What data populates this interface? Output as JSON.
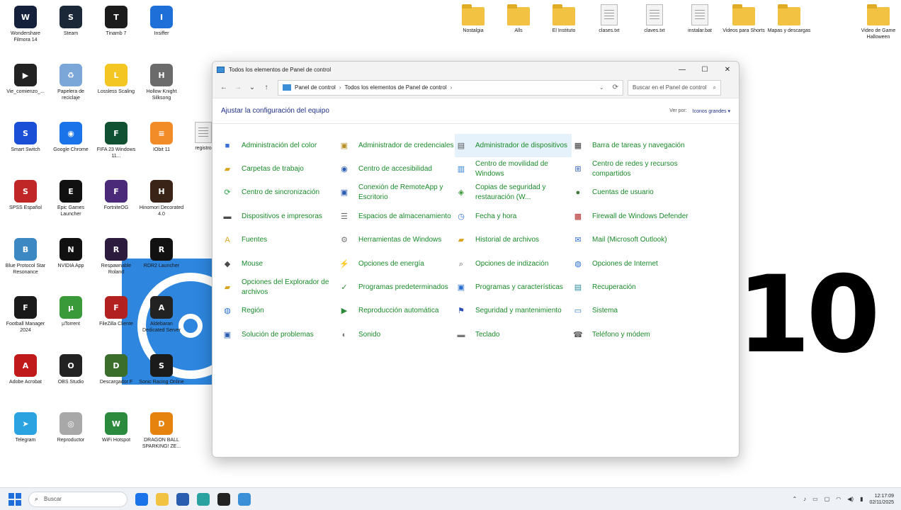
{
  "desktop": {
    "left_icons": [
      {
        "label": "Wondershare Filmora 14",
        "glyph": "W",
        "color": "#15203a"
      },
      {
        "label": "Steam",
        "glyph": "S",
        "color": "#1b2838"
      },
      {
        "label": "Tinamb 7",
        "glyph": "T",
        "color": "#1b1b1b"
      },
      {
        "label": "Insiffer",
        "glyph": "I",
        "color": "#1f6fd9"
      },
      {
        "label": "Vie_comienzo_...",
        "glyph": "▶",
        "color": "#222222"
      },
      {
        "label": "Papelera de reciclaje",
        "glyph": "♻",
        "color": "#7aa7d8"
      },
      {
        "label": "Lossless Scaling",
        "glyph": "L",
        "color": "#f3c623"
      },
      {
        "label": "Hollow Knight Silksong",
        "glyph": "H",
        "color": "#6b6b6b"
      },
      {
        "label": "Smart Switch",
        "glyph": "S",
        "color": "#1a4fd6"
      },
      {
        "label": "Google Chrome",
        "glyph": "◉",
        "color": "#1a73e8"
      },
      {
        "label": "FIFA 23 Windows 11...",
        "glyph": "F",
        "color": "#0f5132"
      },
      {
        "label": "IObit 11",
        "glyph": "≡",
        "color": "#f28c28"
      },
      {
        "label": "SPSS Español",
        "glyph": "S",
        "color": "#c02626"
      },
      {
        "label": "Epic Games Launcher",
        "glyph": "E",
        "color": "#111111"
      },
      {
        "label": "FortniteOG",
        "glyph": "F",
        "color": "#4c2a7a"
      },
      {
        "label": "Hinomori Decorated 4.0",
        "glyph": "H",
        "color": "#3a2418"
      },
      {
        "label": "Blue Protocol Star Resonance",
        "glyph": "B",
        "color": "#3b88c3"
      },
      {
        "label": "NVIDIA App",
        "glyph": "N",
        "color": "#111111"
      },
      {
        "label": "Respawnable Roland",
        "glyph": "R",
        "color": "#2d1b3d"
      },
      {
        "label": "RDR2 Launcher",
        "glyph": "R",
        "color": "#111111"
      },
      {
        "label": "Football Manager 2024",
        "glyph": "F",
        "color": "#1a1a1a"
      },
      {
        "label": "µTorrent",
        "glyph": "µ",
        "color": "#3a9a3a"
      },
      {
        "label": "FileZilla Cliente",
        "glyph": "F",
        "color": "#b32020"
      },
      {
        "label": "Aldebaran Dedicated Server",
        "glyph": "A",
        "color": "#222222"
      },
      {
        "label": "Adobe Acrobat",
        "glyph": "A",
        "color": "#c11a1a"
      },
      {
        "label": "OBS Studio",
        "glyph": "O",
        "color": "#222222"
      },
      {
        "label": "Descargador F",
        "glyph": "D",
        "color": "#3a6e2a"
      },
      {
        "label": "Sonic Racing Online",
        "glyph": "S",
        "color": "#1b1b1b"
      },
      {
        "label": "Telegram",
        "glyph": "➤",
        "color": "#2aa3e0"
      },
      {
        "label": "Reproductor",
        "glyph": "◎",
        "color": "#a8a8a8"
      },
      {
        "label": "WiFi Hotspot",
        "glyph": "W",
        "color": "#2b8a3e"
      },
      {
        "label": "DRAGON BALL SPARKING! ZE...",
        "glyph": "D",
        "color": "#e6820e"
      },
      {
        "label": "registro",
        "glyph": "",
        "color": "#f3f3f3"
      }
    ],
    "top_icons": [
      {
        "label": "Nostalgia",
        "type": "folder"
      },
      {
        "label": "Alls",
        "type": "folder"
      },
      {
        "label": "El Instituto",
        "type": "folder"
      },
      {
        "label": "clases.txt",
        "type": "doc"
      },
      {
        "label": "claves.txt",
        "type": "doc"
      },
      {
        "label": "instalar.bat",
        "type": "doc"
      },
      {
        "label": "Videos para Shorts",
        "type": "folder"
      },
      {
        "label": "Mapas y descargas",
        "type": "folder"
      },
      {
        "label": "Video de Game Halloween",
        "type": "folder"
      }
    ],
    "overlay_number": "10"
  },
  "window": {
    "title": "Todos los elementos de Panel de control",
    "min_glyph": "—",
    "max_glyph": "☐",
    "close_glyph": "✕",
    "nav": {
      "back": "←",
      "forward": "→",
      "recent": "⌄",
      "up": "↑"
    },
    "path": [
      "Panel de control",
      "Todos los elementos de Panel de control"
    ],
    "path_sep": "›",
    "path_dropdown": "⌄",
    "refresh": "⟳",
    "search_placeholder": "Buscar en el Panel de control",
    "search_icon": "⌕",
    "heading": "Ajustar la configuración del equipo",
    "view_by_label": "Ver por:",
    "view_by_value": "Iconos grandes ▾",
    "items": [
      {
        "label": "Administración del color",
        "icon": "color-management-icon",
        "glyph": "■",
        "color": "#3b6fd6"
      },
      {
        "label": "Administrador de credenciales",
        "icon": "credential-manager-icon",
        "glyph": "▣",
        "color": "#b8902a"
      },
      {
        "label": "Administrador de dispositivos",
        "icon": "device-manager-icon",
        "glyph": "▤",
        "color": "#555555",
        "selected": true
      },
      {
        "label": "Barra de tareas y navegación",
        "icon": "taskbar-icon",
        "glyph": "▦",
        "color": "#3a3a3a"
      },
      {
        "label": "Carpetas de trabajo",
        "icon": "work-folders-icon",
        "glyph": "▰",
        "color": "#d9a420"
      },
      {
        "label": "Centro de accesibilidad",
        "icon": "accessibility-icon",
        "glyph": "◉",
        "color": "#2a5db0"
      },
      {
        "label": "Centro de movilidad de Windows",
        "icon": "mobility-center-icon",
        "glyph": "▥",
        "color": "#2a7ad0"
      },
      {
        "label": "Centro de redes y recursos compartidos",
        "icon": "network-center-icon",
        "glyph": "⊞",
        "color": "#2a5db0"
      },
      {
        "label": "Centro de sincronización",
        "icon": "sync-center-icon",
        "glyph": "⟳",
        "color": "#2aa84a"
      },
      {
        "label": "Conexión de RemoteApp y Escritorio",
        "icon": "remoteapp-icon",
        "glyph": "▣",
        "color": "#2a5db0"
      },
      {
        "label": "Copias de seguridad y restauración (W...",
        "icon": "backup-icon",
        "glyph": "◈",
        "color": "#3a9a3a"
      },
      {
        "label": "Cuentas de usuario",
        "icon": "user-accounts-icon",
        "glyph": "●",
        "color": "#3a7a3a"
      },
      {
        "label": "Dispositivos e impresoras",
        "icon": "printer-icon",
        "glyph": "▬",
        "color": "#4a4a4a"
      },
      {
        "label": "Espacios de almacenamiento",
        "icon": "storage-spaces-icon",
        "glyph": "☰",
        "color": "#6a6a6a"
      },
      {
        "label": "Fecha y hora",
        "icon": "date-time-icon",
        "glyph": "◷",
        "color": "#2a6fd0"
      },
      {
        "label": "Firewall de Windows Defender",
        "icon": "firewall-icon",
        "glyph": "▩",
        "color": "#b02a2a"
      },
      {
        "label": "Fuentes",
        "icon": "fonts-icon",
        "glyph": "A",
        "color": "#d9a420"
      },
      {
        "label": "Herramientas de Windows",
        "icon": "windows-tools-icon",
        "glyph": "⚙",
        "color": "#777777"
      },
      {
        "label": "Historial de archivos",
        "icon": "file-history-icon",
        "glyph": "▰",
        "color": "#d9a420"
      },
      {
        "label": "Mail (Microsoft Outlook)",
        "icon": "mail-icon",
        "glyph": "✉",
        "color": "#2a6fd0"
      },
      {
        "label": "Mouse",
        "icon": "mouse-icon",
        "glyph": "◆",
        "color": "#4a4a4a"
      },
      {
        "label": "Opciones de energía",
        "icon": "power-options-icon",
        "glyph": "⚡",
        "color": "#2a8a2a"
      },
      {
        "label": "Opciones de indización",
        "icon": "indexing-icon",
        "glyph": "⌕",
        "color": "#555555"
      },
      {
        "label": "Opciones de Internet",
        "icon": "internet-options-icon",
        "glyph": "◍",
        "color": "#2a6fd0"
      },
      {
        "label": "Opciones del Explorador de archivos",
        "icon": "explorer-options-icon",
        "glyph": "▰",
        "color": "#d9a420"
      },
      {
        "label": "Programas predeterminados",
        "icon": "default-programs-icon",
        "glyph": "✓",
        "color": "#2a8a3a"
      },
      {
        "label": "Programas y características",
        "icon": "programs-features-icon",
        "glyph": "▣",
        "color": "#2a6fd0"
      },
      {
        "label": "Recuperación",
        "icon": "recovery-icon",
        "glyph": "▤",
        "color": "#2a8aa0"
      },
      {
        "label": "Región",
        "icon": "region-icon",
        "glyph": "◍",
        "color": "#2a6fd0"
      },
      {
        "label": "Reproducción automática",
        "icon": "autoplay-icon",
        "glyph": "▶",
        "color": "#2a8a3a"
      },
      {
        "label": "Seguridad y mantenimiento",
        "icon": "security-flag-icon",
        "glyph": "⚑",
        "color": "#2a4fb0"
      },
      {
        "label": "Sistema",
        "icon": "system-icon",
        "glyph": "▭",
        "color": "#2a7ad0"
      },
      {
        "label": "Solución de problemas",
        "icon": "troubleshoot-icon",
        "glyph": "▣",
        "color": "#2a5db0"
      },
      {
        "label": "Sonido",
        "icon": "sound-icon",
        "glyph": "◐",
        "color": "#777777"
      },
      {
        "label": "Teclado",
        "icon": "keyboard-icon",
        "glyph": "▬",
        "color": "#777777"
      },
      {
        "label": "Teléfono y módem",
        "icon": "phone-modem-icon",
        "glyph": "☎",
        "color": "#555555"
      }
    ]
  },
  "taskbar": {
    "search_placeholder": "Buscar",
    "search_icon": "⌕",
    "apps": [
      {
        "name": "chrome-taskbar-icon",
        "color": "#1a73e8"
      },
      {
        "name": "file-explorer-taskbar-icon",
        "color": "#f2c243"
      },
      {
        "name": "store-taskbar-icon",
        "color": "#2a5db0"
      },
      {
        "name": "edge-taskbar-icon",
        "color": "#2aa3a0"
      },
      {
        "name": "obs-taskbar-icon",
        "color": "#222222"
      },
      {
        "name": "control-panel-taskbar-icon",
        "color": "#3b8fd6"
      }
    ],
    "tray_icons": [
      "⌃",
      "♪",
      "▭",
      "▢",
      "◠",
      "◀)",
      "▮"
    ],
    "time": "12:17:09",
    "date": "02/11/2025"
  }
}
